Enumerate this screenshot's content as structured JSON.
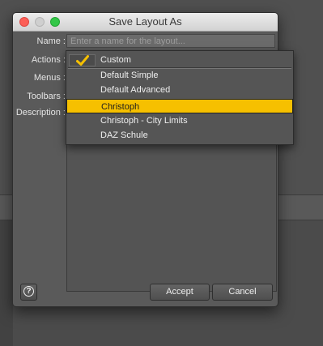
{
  "dialog": {
    "title": "Save Layout As",
    "labels": {
      "name": "Name :",
      "actions": "Actions :",
      "menus": "Menus :",
      "toolbars": "Toolbars :",
      "description": "Description :"
    },
    "name_field": {
      "value": "",
      "placeholder": "Enter a name for the layout..."
    },
    "buttons": {
      "help": "?",
      "accept": "Accept",
      "cancel": "Cancel"
    }
  },
  "dropdown": {
    "checked_index": 0,
    "selected_index": 3,
    "items": [
      {
        "label": "Custom"
      },
      {
        "label": "Default Simple"
      },
      {
        "label": "Default Advanced"
      },
      {
        "label": "Christoph"
      },
      {
        "label": "Christoph - City Limits"
      },
      {
        "label": "DAZ Schule"
      }
    ]
  },
  "colors": {
    "highlight": "#f6c000",
    "checkmark": "#f6c000",
    "close_button": "#fc5f57",
    "zoom_button": "#33c748"
  },
  "icons": {
    "help": "question-circle-icon",
    "check": "checkmark-icon"
  }
}
